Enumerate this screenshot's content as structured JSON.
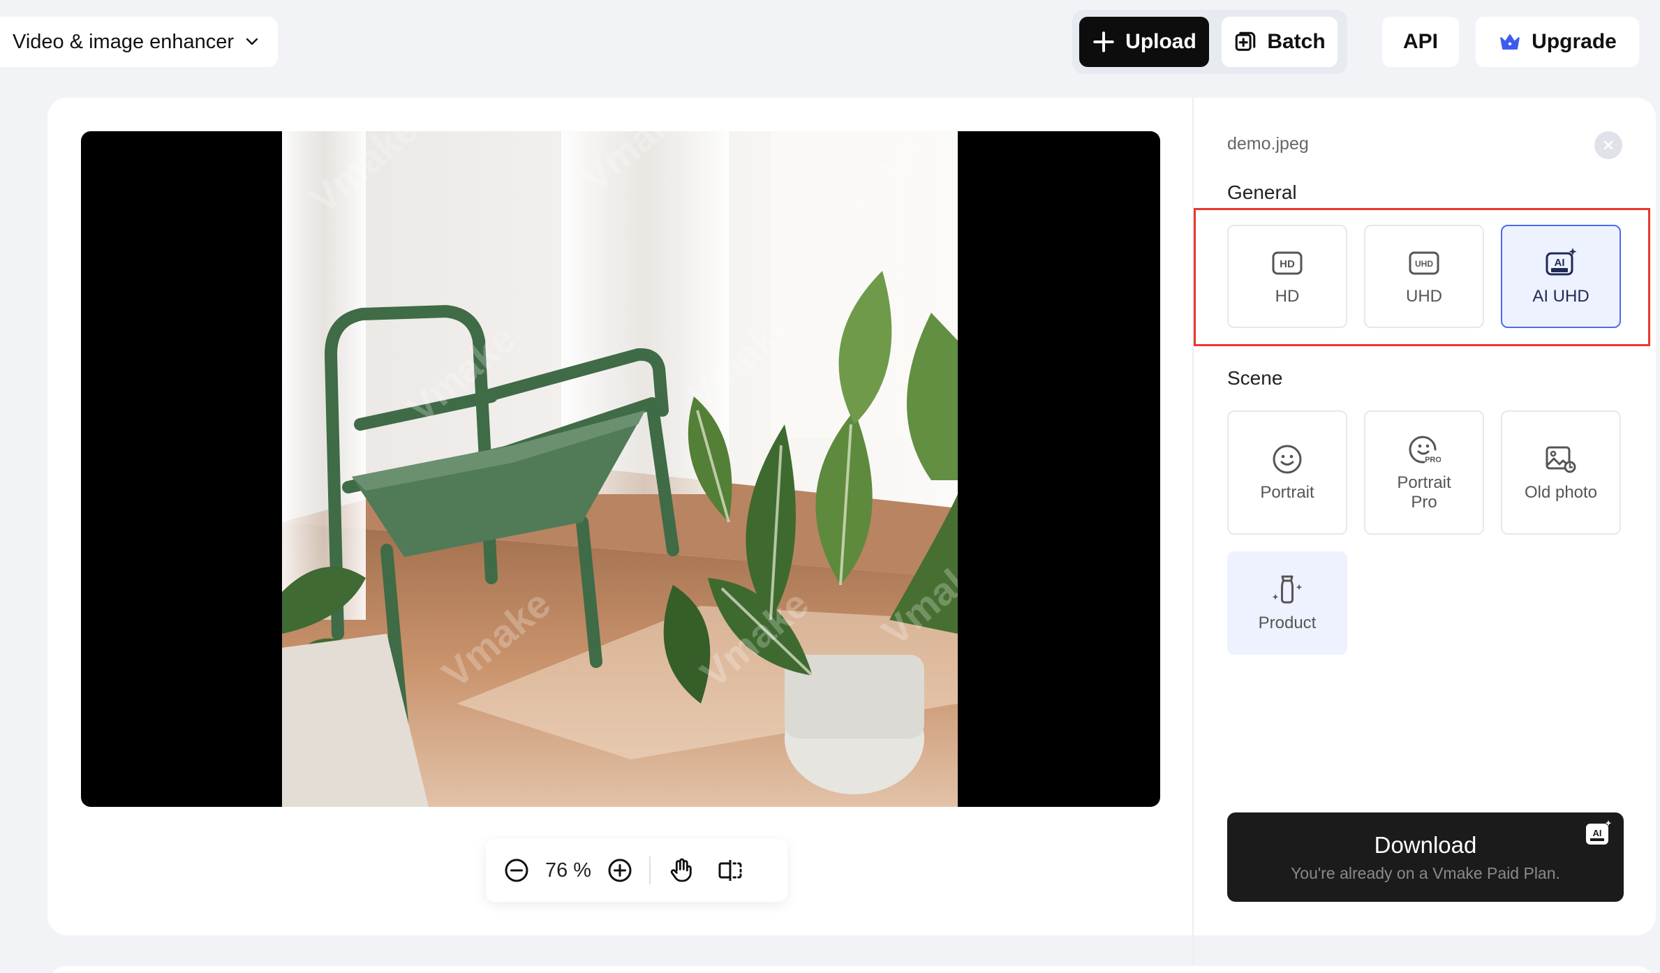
{
  "header": {
    "tool_selector": "Video & image enhancer",
    "upload_label": "Upload",
    "batch_label": "Batch",
    "api_label": "API",
    "upgrade_label": "Upgrade"
  },
  "preview": {
    "watermark": "Vmake",
    "zoom_value": "76 %"
  },
  "panel": {
    "filename": "demo.jpeg",
    "general_title": "General",
    "general_options": [
      {
        "label": "HD",
        "icon": "hd-icon",
        "selected": false
      },
      {
        "label": "UHD",
        "icon": "uhd-icon",
        "selected": false
      },
      {
        "label": "AI UHD",
        "icon": "ai-ultra-icon",
        "selected": true
      }
    ],
    "scene_title": "Scene",
    "scene_options": [
      {
        "label": "Portrait",
        "icon": "smile-icon"
      },
      {
        "label": "Portrait\nPro",
        "icon": "smile-pro-icon"
      },
      {
        "label": "Old photo",
        "icon": "old-photo-icon"
      },
      {
        "label": "Product",
        "icon": "product-icon"
      }
    ],
    "download_label": "Download",
    "download_sub": "You're already on a Vmake Paid Plan."
  },
  "colors": {
    "accent": "#4d6af2",
    "highlight": "#e8372c",
    "dark_button": "#0d0d0d"
  }
}
